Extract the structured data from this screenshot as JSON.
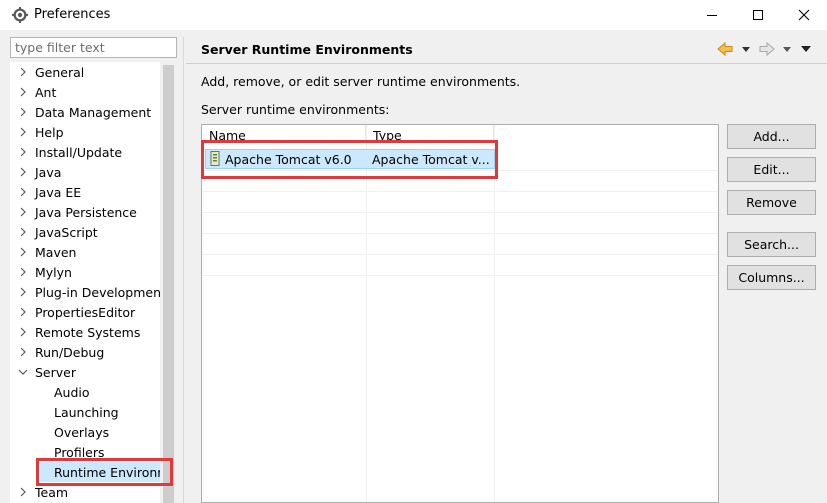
{
  "window": {
    "title": "Preferences",
    "controls": {
      "minimize": "minimize",
      "maximize": "maximize",
      "close": "close"
    }
  },
  "sidebar": {
    "filter_placeholder": "type filter text",
    "items": [
      {
        "label": "General",
        "expanded": false,
        "level": 0
      },
      {
        "label": "Ant",
        "expanded": false,
        "level": 0
      },
      {
        "label": "Data Management",
        "expanded": false,
        "level": 0
      },
      {
        "label": "Help",
        "expanded": false,
        "level": 0
      },
      {
        "label": "Install/Update",
        "expanded": false,
        "level": 0
      },
      {
        "label": "Java",
        "expanded": false,
        "level": 0
      },
      {
        "label": "Java EE",
        "expanded": false,
        "level": 0
      },
      {
        "label": "Java Persistence",
        "expanded": false,
        "level": 0
      },
      {
        "label": "JavaScript",
        "expanded": false,
        "level": 0
      },
      {
        "label": "Maven",
        "expanded": false,
        "level": 0
      },
      {
        "label": "Mylyn",
        "expanded": false,
        "level": 0
      },
      {
        "label": "Plug-in Development",
        "expanded": false,
        "level": 0
      },
      {
        "label": "PropertiesEditor",
        "expanded": false,
        "level": 0
      },
      {
        "label": "Remote Systems",
        "expanded": false,
        "level": 0
      },
      {
        "label": "Run/Debug",
        "expanded": false,
        "level": 0
      },
      {
        "label": "Server",
        "expanded": true,
        "level": 0
      },
      {
        "label": "Audio",
        "level": 1
      },
      {
        "label": "Launching",
        "level": 1
      },
      {
        "label": "Overlays",
        "level": 1
      },
      {
        "label": "Profilers",
        "level": 1
      },
      {
        "label": "Runtime Environm",
        "level": 1,
        "selected": true
      },
      {
        "label": "Team",
        "expanded": false,
        "level": 0
      }
    ]
  },
  "main": {
    "title": "Server Runtime Environments",
    "description": "Add, remove, or edit server runtime environments.",
    "list_label": "Server runtime environments:",
    "table": {
      "columns": [
        "Name",
        "Type"
      ],
      "rows": [
        {
          "name": "Apache Tomcat v6.0",
          "type": "Apache Tomcat v...",
          "selected": true
        }
      ]
    },
    "buttons": {
      "add": "Add...",
      "edit": "Edit...",
      "remove": "Remove",
      "search": "Search...",
      "columns": "Columns..."
    }
  },
  "colors": {
    "highlight": "#e0393b",
    "selection": "#cce8ff",
    "nav_back": "#e0a030"
  },
  "icons": {
    "app": "gear-icon",
    "back": "back-arrow-icon",
    "forward": "forward-arrow-icon",
    "menu": "view-menu-icon",
    "server": "server-runtime-icon"
  }
}
